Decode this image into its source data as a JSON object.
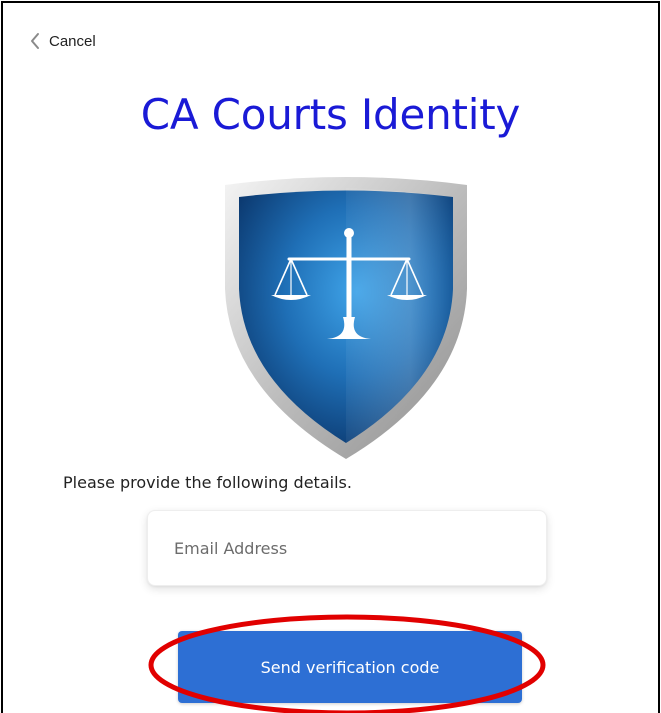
{
  "header": {
    "cancel_label": "Cancel",
    "cancel_icon": "chevron-left-icon"
  },
  "brand": {
    "title": "CA Courts Identity",
    "title_color": "#1a1ad6",
    "logo_icon": "shield-scales-icon",
    "shield_color": "#1f6fb6",
    "shield_rim_color": "#c9c9c9"
  },
  "form": {
    "instructions": "Please provide the following details.",
    "email": {
      "value": "",
      "placeholder": "Email Address"
    },
    "send_button_label": "Send verification code",
    "button_color": "#2d6fd4"
  },
  "annotation": {
    "highlight_color": "#e10000"
  }
}
